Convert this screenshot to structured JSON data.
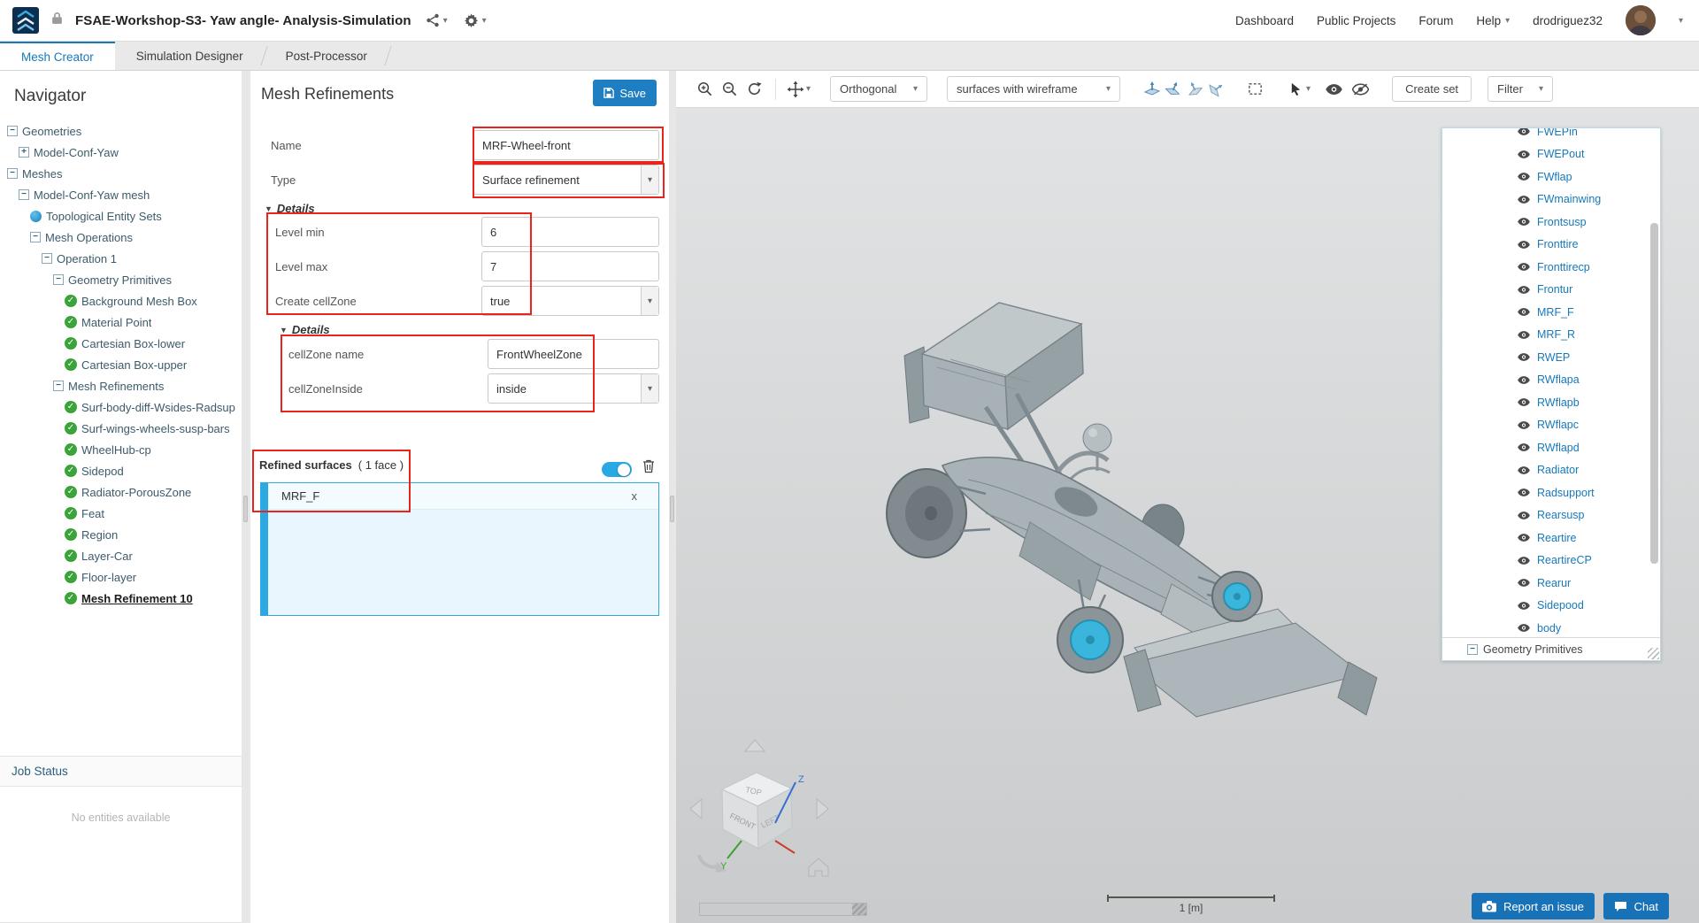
{
  "topbar": {
    "title": "FSAE-Workshop-S3- Yaw angle- Analysis-Simulation",
    "nav_links": [
      {
        "label": "Dashboard",
        "chevron": false
      },
      {
        "label": "Public Projects",
        "chevron": false
      },
      {
        "label": "Forum",
        "chevron": false
      },
      {
        "label": "Help",
        "chevron": true
      }
    ],
    "username": "drodriguez32"
  },
  "tabs": [
    {
      "label": "Mesh Creator",
      "active": true
    },
    {
      "label": "Simulation Designer",
      "active": false
    },
    {
      "label": "Post-Processor",
      "active": false
    }
  ],
  "navigator": {
    "title": "Navigator",
    "job_status_title": "Job Status",
    "job_status_empty": "No entities available",
    "tree": [
      {
        "label": "Geometries",
        "depth": 0,
        "icon": "minus"
      },
      {
        "label": "Model-Conf-Yaw",
        "depth": 1,
        "icon": "plus"
      },
      {
        "label": "Meshes",
        "depth": 0,
        "icon": "minus"
      },
      {
        "label": "Model-Conf-Yaw mesh",
        "depth": 1,
        "icon": "minus"
      },
      {
        "label": "Topological Entity Sets",
        "depth": 2,
        "icon": "dot"
      },
      {
        "label": "Mesh Operations",
        "depth": 2,
        "icon": "minus"
      },
      {
        "label": "Operation 1",
        "depth": 3,
        "icon": "minus"
      },
      {
        "label": "Geometry Primitives",
        "depth": 4,
        "icon": "minus"
      },
      {
        "label": "Background Mesh Box",
        "depth": 5,
        "icon": "check"
      },
      {
        "label": "Material Point",
        "depth": 5,
        "icon": "check"
      },
      {
        "label": "Cartesian Box-lower",
        "depth": 5,
        "icon": "check"
      },
      {
        "label": "Cartesian Box-upper",
        "depth": 5,
        "icon": "check"
      },
      {
        "label": "Mesh Refinements",
        "depth": 4,
        "icon": "minus"
      },
      {
        "label": "Surf-body-diff-Wsides-Radsup",
        "depth": 5,
        "icon": "check"
      },
      {
        "label": "Surf-wings-wheels-susp-bars",
        "depth": 5,
        "icon": "check"
      },
      {
        "label": "WheelHub-cp",
        "depth": 5,
        "icon": "check"
      },
      {
        "label": "Sidepod",
        "depth": 5,
        "icon": "check"
      },
      {
        "label": "Radiator-PorousZone",
        "depth": 5,
        "icon": "check"
      },
      {
        "label": "Feat",
        "depth": 5,
        "icon": "check"
      },
      {
        "label": "Region",
        "depth": 5,
        "icon": "check"
      },
      {
        "label": "Layer-Car",
        "depth": 5,
        "icon": "check"
      },
      {
        "label": "Floor-layer",
        "depth": 5,
        "icon": "check"
      },
      {
        "label": "Mesh Refinement 10",
        "depth": 5,
        "icon": "check",
        "selected": true
      }
    ]
  },
  "properties": {
    "title": "Mesh Refinements",
    "save_label": "Save",
    "name_label": "Name",
    "name_value": "MRF-Wheel-front",
    "type_label": "Type",
    "type_value": "Surface refinement",
    "details_label": "Details",
    "level_min_label": "Level min",
    "level_min_value": "6",
    "level_max_label": "Level max",
    "level_max_value": "7",
    "create_cellzone_label": "Create cellZone",
    "create_cellzone_value": "true",
    "subdetails_label": "Details",
    "cellzone_name_label": "cellZone name",
    "cellzone_name_value": "FrontWheelZone",
    "cellzone_inside_label": "cellZoneInside",
    "cellzone_inside_value": "inside",
    "refined_label": "Refined surfaces",
    "refined_count": "( 1 face )",
    "chip_label": "MRF_F",
    "chip_remove": "x"
  },
  "viewport": {
    "projection": "Orthogonal",
    "render_mode": "surfaces with wireframe",
    "create_set_label": "Create set",
    "filter_label": "Filter",
    "scale_label": "1 [m]",
    "report_label": "Report an issue",
    "chat_label": "Chat",
    "faces_footer": "Geometry Primitives",
    "faces": [
      "FWEPin",
      "FWEPout",
      "FWflap",
      "FWmainwing",
      "Frontsusp",
      "Fronttire",
      "Fronttirecp",
      "Frontur",
      "MRF_F",
      "MRF_R",
      "RWEP",
      "RWflapa",
      "RWflapb",
      "RWflapc",
      "RWflapd",
      "Radiator",
      "Radsupport",
      "Rearsusp",
      "Reartire",
      "ReartireCP",
      "Rearur",
      "Sidepood",
      "body"
    ],
    "cube": {
      "top": "TOP",
      "front": "FRONT",
      "left": "LEFT",
      "axis_z": "Z",
      "axis_y": "Y"
    }
  },
  "colors": {
    "accent": "#1779ba",
    "annotation": "#e8251d",
    "selection_border": "#2da9e1",
    "selection_fill": "#e9f6fd",
    "wheel_hub_cyan": "#3ab6dc",
    "save_button": "#1f7ec2"
  }
}
